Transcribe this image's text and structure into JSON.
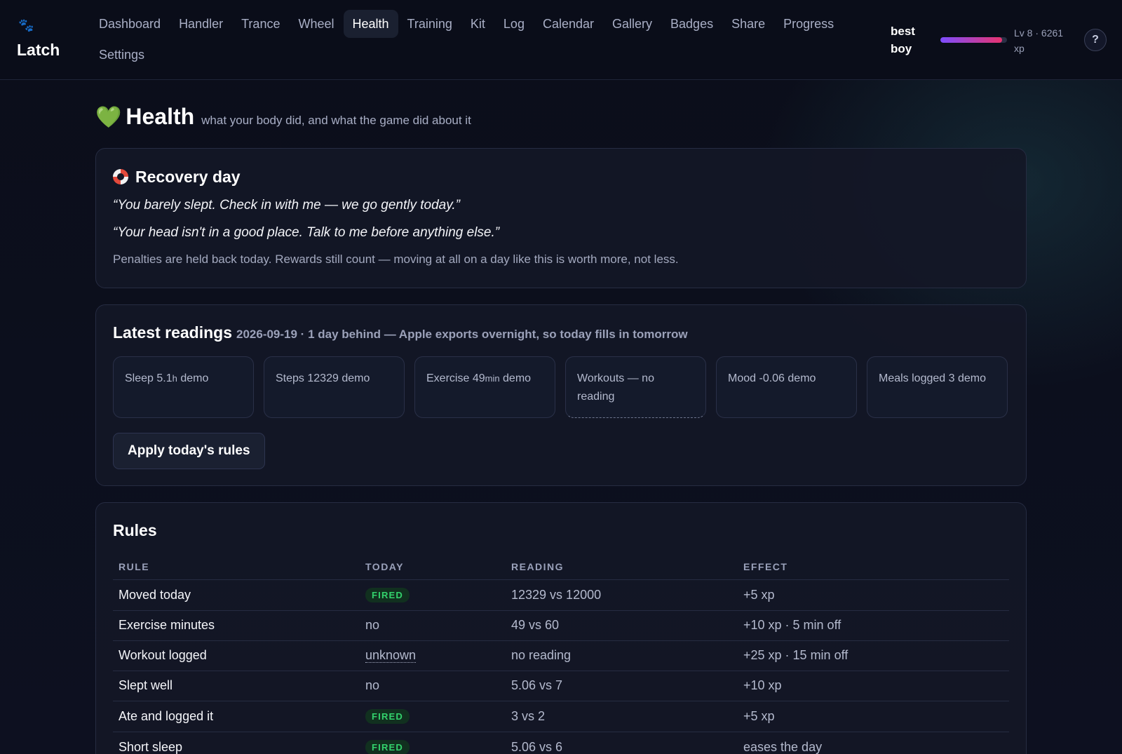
{
  "app": {
    "name": "Latch",
    "icon": "paw-icon"
  },
  "nav": {
    "items": [
      "Dashboard",
      "Handler",
      "Trance",
      "Wheel",
      "Health",
      "Training",
      "Kit",
      "Log",
      "Calendar",
      "Gallery",
      "Badges",
      "Share",
      "Progress",
      "Settings"
    ],
    "active": "Health"
  },
  "user": {
    "name_line1": "best",
    "name_line2": "boy",
    "level_line1": "Lv 8 · 6261",
    "level_line2": "xp",
    "xp_progress_fraction": 0.93,
    "help_label": "?"
  },
  "page": {
    "icon": "green-heart-icon",
    "title": "Health",
    "subtitle": "what your body did, and what the game did about it"
  },
  "recovery": {
    "icon": "lifebuoy-icon",
    "title": "Recovery day",
    "quotes": [
      "“You barely slept. Check in with me — we go gently today.”",
      "“Your head isn't in a good place. Talk to me before anything else.”"
    ],
    "note": "Penalties are held back today. Rewards still count — moving at all on a day like this is worth more, not less."
  },
  "readings": {
    "title": "Latest readings",
    "subtitle": "2026-09-19 · 1 day behind — Apple exports overnight, so today fills in tomorrow",
    "tiles": [
      {
        "label": "Sleep",
        "value": "5.1",
        "unit": "h",
        "suffix": "demo"
      },
      {
        "label": "Steps",
        "value": "12329",
        "unit": "",
        "suffix": "demo"
      },
      {
        "label": "Exercise",
        "value": "49",
        "unit": "min",
        "suffix": "demo"
      },
      {
        "label": "Workouts — no reading",
        "value": "",
        "unit": "",
        "suffix": ""
      },
      {
        "label": "Mood",
        "value": "-0.06",
        "unit": "",
        "suffix": "demo"
      },
      {
        "label": "Meals logged",
        "value": "3",
        "unit": "",
        "suffix": "demo"
      }
    ],
    "apply_label": "Apply today's rules"
  },
  "rules": {
    "title": "Rules",
    "columns": [
      "RULE",
      "TODAY",
      "READING",
      "EFFECT"
    ],
    "rows": [
      {
        "rule": "Moved today",
        "today": "FIRED",
        "reading": "12329 vs 12000",
        "effect": "+5 xp"
      },
      {
        "rule": "Exercise minutes",
        "today": "no",
        "reading": "49 vs 60",
        "effect": "+10 xp · 5 min off"
      },
      {
        "rule": "Workout logged",
        "today": "unknown",
        "reading": "no reading",
        "effect": "+25 xp · 15 min off"
      },
      {
        "rule": "Slept well",
        "today": "no",
        "reading": "5.06 vs 7",
        "effect": "+10 xp"
      },
      {
        "rule": "Ate and logged it",
        "today": "FIRED",
        "reading": "3 vs 2",
        "effect": "+5 xp"
      },
      {
        "rule": "Short sleep",
        "today": "FIRED",
        "reading": "5.06 vs 6",
        "effect": "eases the day"
      }
    ]
  },
  "colors": {
    "background": "#0b0e1a",
    "card": "#131726",
    "accent_fired": "#33d26c",
    "xp_gradient_start": "#7c4dff",
    "xp_gradient_end": "#e8336f"
  }
}
